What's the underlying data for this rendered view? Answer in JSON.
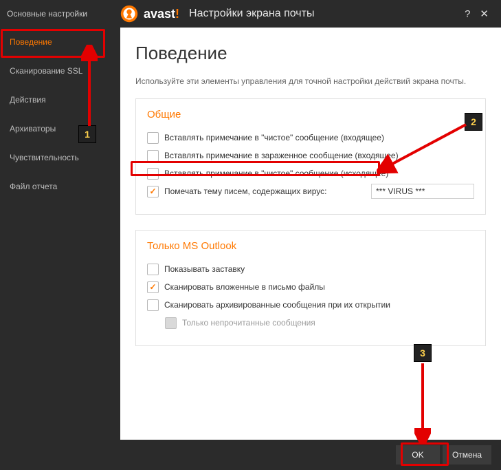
{
  "titlebar": {
    "top_left": "Основные настройки",
    "brand": "avast",
    "bang": "!",
    "title": "Настройки экрана почты",
    "help": "?",
    "close": "✕"
  },
  "sidebar": {
    "items": [
      "Поведение",
      "Сканирование SSL",
      "Действия",
      "Архиваторы",
      "Чувствительность",
      "Файл отчета"
    ]
  },
  "content": {
    "heading": "Поведение",
    "description": "Используйте эти элементы управления для точной настройки действий экрана почты.",
    "general": {
      "title": "Общие",
      "opt1": "Вставлять примечание в \"чистое\" сообщение (входящее)",
      "opt2": "Вставлять примечание в зараженное сообщение (входящее)",
      "opt3": "Вставлять примечание в \"чистое\" сообщение (исходящее)",
      "opt4": "Помечать тему писем, содержащих вирус:",
      "virus_text": "*** VIRUS ***"
    },
    "outlook": {
      "title": "Только MS Outlook",
      "opt1": "Показывать заставку",
      "opt2": "Сканировать вложенные в письмо файлы",
      "opt3": "Сканировать архивированные сообщения при их открытии",
      "opt4": "Только непрочитанные сообщения"
    }
  },
  "footer": {
    "ok": "OK",
    "cancel": "Отмена"
  },
  "annotations": {
    "b1": "1",
    "b2": "2",
    "b3": "3"
  }
}
